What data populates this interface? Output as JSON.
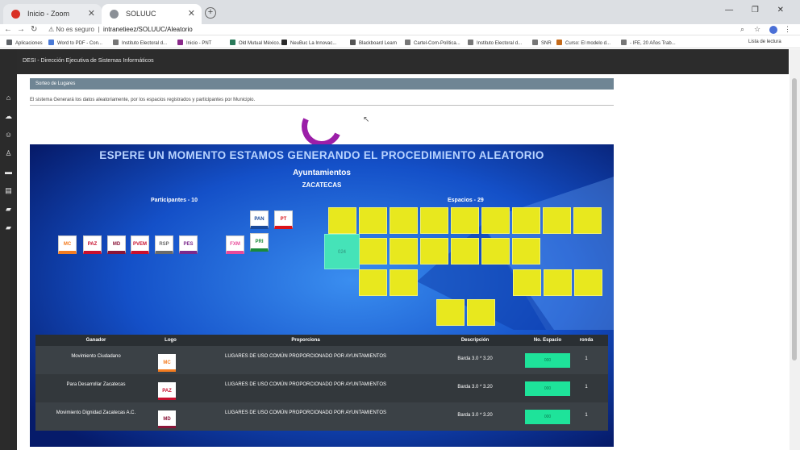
{
  "browser": {
    "tabs": [
      {
        "label": "Inicio - Zoom"
      },
      {
        "label": "SOLUUC"
      }
    ],
    "new_tab": "+",
    "window_controls": "— ❐ ✕",
    "url_prefix": "No es seguro",
    "url": "intranetieez/SOLUUC/Aleatorio",
    "bookmarks": [
      {
        "label": "Aplicaciones",
        "color": "#5f6368"
      },
      {
        "label": "Word to PDF - Con...",
        "color": "#4a7ad6"
      },
      {
        "label": "Instituto Electoral d...",
        "color": "#777"
      },
      {
        "label": "Inicio - PNT",
        "color": "#8a2a8a"
      },
      {
        "label": "Old Mutual México...",
        "color": "#2a7a5a"
      },
      {
        "label": "NeuBuc La Innovac...",
        "color": "#2a2a2a"
      },
      {
        "label": "Blackboard Learn",
        "color": "#555"
      },
      {
        "label": "Cartel-Corn-Política...",
        "color": "#777"
      },
      {
        "label": "Instituto Electoral d...",
        "color": "#777"
      },
      {
        "label": "SNR",
        "color": "#777"
      },
      {
        "label": "Curso: El modelo d...",
        "color": "#c46a1a"
      },
      {
        "label": "- IFE, 20 Años Trab...",
        "color": "#777"
      }
    ],
    "reading_list": "Lista de lectura"
  },
  "app": {
    "title": "DESI - Dirección Ejecutiva de Sistemas Informáticos",
    "panel_title": "Sorteo de Lugares",
    "description": "El sistema Generará los datos aleatoriamente, por los espacios registrados y participantes por Municipio.",
    "sidebar_icons": [
      "home-icon",
      "cloud-icon",
      "users-icon",
      "person-icon",
      "car-icon",
      "table-icon",
      "folder-icon",
      "folder-icon"
    ]
  },
  "stage": {
    "message": "ESPERE UN MOMENTO ESTAMOS GENERANDO EL PROCEDIMIENTO ALEATORIO",
    "subtitle": "Ayuntamientos",
    "state": "ZACATECAS",
    "participants_label": "Participantes - 10",
    "spaces_label": "Espacios - 29",
    "participants": [
      {
        "abbr": "MC",
        "color": "#f47c20"
      },
      {
        "abbr": "PAZ",
        "color": "#c8102e"
      },
      {
        "abbr": "MD",
        "color": "#8a1538"
      },
      {
        "abbr": "PVEM",
        "color": "#c8102e"
      },
      {
        "abbr": "RSP",
        "color": "#6b6b6b"
      },
      {
        "abbr": "PES",
        "color": "#7b2a8c"
      },
      {
        "abbr": "FXM",
        "color": "#e84a9a"
      },
      {
        "abbr": "PAN",
        "color": "#1a4a9a"
      },
      {
        "abbr": "PT",
        "color": "#d9141b"
      },
      {
        "abbr": "PRI",
        "color": "#1a8a3a"
      }
    ],
    "selected_space": "024"
  },
  "table": {
    "headers": [
      "Ganador",
      "Logo",
      "Proporciona",
      "Descripción",
      "No. Espacio",
      "ronda"
    ],
    "rows": [
      {
        "winner": "Movimiento Ciudadano",
        "logo": "MC",
        "logo_color": "#f47c20",
        "provides": "LUGARES DE USO COMÚN PROPORCIONADO POR AYUNTAMIENTOS",
        "description": "Barda 3.0 * 3.20",
        "space": "000",
        "round": "1"
      },
      {
        "winner": "Para Desarrollar Zacatecas",
        "logo": "PAZ",
        "logo_color": "#c8102e",
        "provides": "LUGARES DE USO COMÚN PROPORCIONADO POR AYUNTAMIENTOS",
        "description": "Barda 3.0 * 3.20",
        "space": "000",
        "round": "1"
      },
      {
        "winner": "Movimiento Dignidad Zacatecas A.C.",
        "logo": "MD",
        "logo_color": "#8a1538",
        "provides": "LUGARES DE USO COMÚN PROPORCIONADO POR AYUNTAMIENTOS",
        "description": "Barda 3.0 * 3.20",
        "space": "000",
        "round": "1"
      }
    ]
  },
  "colors": {
    "slot": "#e8e81e",
    "selected_slot": "#45e3b8",
    "spinner": "#9b1ea8",
    "space_badge": "#1ee39a",
    "stage_bg": "#0a2a8c"
  }
}
